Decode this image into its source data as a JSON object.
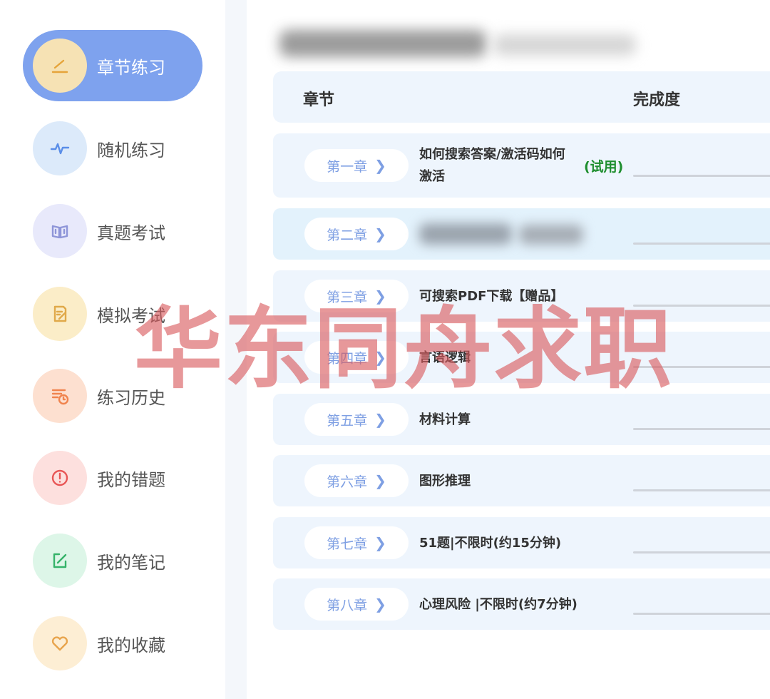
{
  "sidebar": {
    "items": [
      {
        "label": "章节练习",
        "icon": "pen-icon",
        "bg": "#f6e2b4",
        "color": "#e6a43a",
        "active": true
      },
      {
        "label": "随机练习",
        "icon": "pulse-icon",
        "bg": "#dceafa",
        "color": "#5a8ee8",
        "active": false
      },
      {
        "label": "真题考试",
        "icon": "book-icon",
        "bg": "#e8e9fb",
        "color": "#8e95d8",
        "active": false
      },
      {
        "label": "模拟考试",
        "icon": "edit-doc-icon",
        "bg": "#fbedc8",
        "color": "#e0a94a",
        "active": false
      },
      {
        "label": "练习历史",
        "icon": "history-icon",
        "bg": "#fde0d0",
        "color": "#f0844e",
        "active": false
      },
      {
        "label": "我的错题",
        "icon": "alert-icon",
        "bg": "#fde0de",
        "color": "#e85555",
        "active": false
      },
      {
        "label": "我的笔记",
        "icon": "note-icon",
        "bg": "#ddf6e8",
        "color": "#36b36a",
        "active": false
      },
      {
        "label": "我的收藏",
        "icon": "heart-icon",
        "bg": "#fdeed4",
        "color": "#e8a44c",
        "active": false
      }
    ]
  },
  "table": {
    "header": {
      "chapter": "章节",
      "completion": "完成度"
    },
    "rows": [
      {
        "chapter": "第一章",
        "title": "如何搜索答案/激活码如何激活",
        "badge": "(试用)",
        "blurred": false,
        "progress": 0
      },
      {
        "chapter": "第二章",
        "title": "",
        "badge": "",
        "blurred": true,
        "progress": 0
      },
      {
        "chapter": "第三章",
        "title": "可搜索PDF下载【赠品】",
        "badge": "",
        "blurred": false,
        "progress": 0
      },
      {
        "chapter": "第四章",
        "title": "言语逻辑",
        "badge": "",
        "blurred": false,
        "progress": 0
      },
      {
        "chapter": "第五章",
        "title": "材料计算",
        "badge": "",
        "blurred": false,
        "progress": 0
      },
      {
        "chapter": "第六章",
        "title": "图形推理",
        "badge": "",
        "blurred": false,
        "progress": 0
      },
      {
        "chapter": "第七章",
        "title": "51题|不限时(约15分钟)",
        "badge": "",
        "blurred": false,
        "progress": 0
      },
      {
        "chapter": "第八章",
        "title": "心理风险 |不限时(约7分钟)",
        "badge": "",
        "blurred": false,
        "progress": 0
      }
    ]
  },
  "watermark": "华东同舟求职",
  "colors": {
    "accent": "#7ea2ee",
    "chapter_text": "#7e9fe3",
    "trial": "#1e8e2e",
    "row_bg": "#eef5fd"
  }
}
